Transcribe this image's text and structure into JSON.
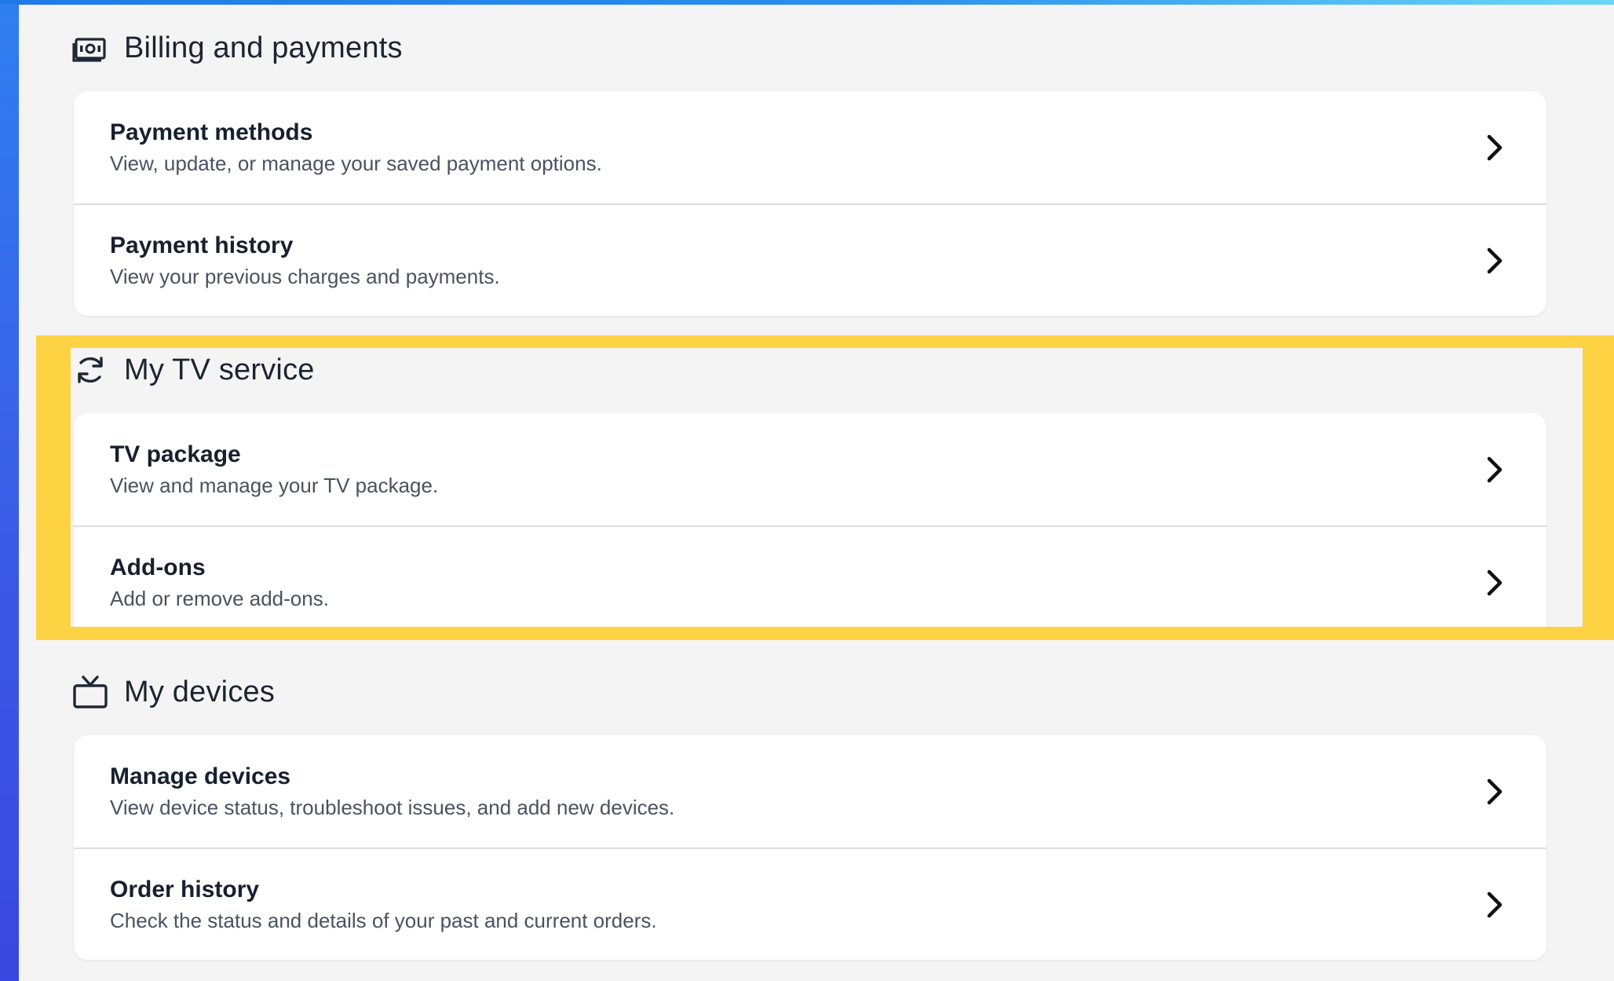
{
  "colors": {
    "panel_bg": "#f4f4f5",
    "card_bg": "#ffffff",
    "highlight": "#fdd344",
    "title_text": "#17202d",
    "desc_text": "#4a5260"
  },
  "sections": [
    {
      "icon": "cash-icon",
      "title": "Billing and payments",
      "items": [
        {
          "title": "Payment methods",
          "description": "View, update, or manage your saved payment options."
        },
        {
          "title": "Payment history",
          "description": "View your previous charges and payments."
        }
      ]
    },
    {
      "icon": "refresh-icon",
      "title": "My TV service",
      "items": [
        {
          "title": "TV package",
          "description": "View and manage your TV package."
        },
        {
          "title": "Add-ons",
          "description": "Add or remove add-ons."
        }
      ]
    },
    {
      "icon": "tv-icon",
      "title": "My devices",
      "items": [
        {
          "title": "Manage devices",
          "description": "View device status, troubleshoot issues, and add new devices."
        },
        {
          "title": "Order history",
          "description": "Check the status and details of your past and current orders."
        }
      ]
    }
  ]
}
